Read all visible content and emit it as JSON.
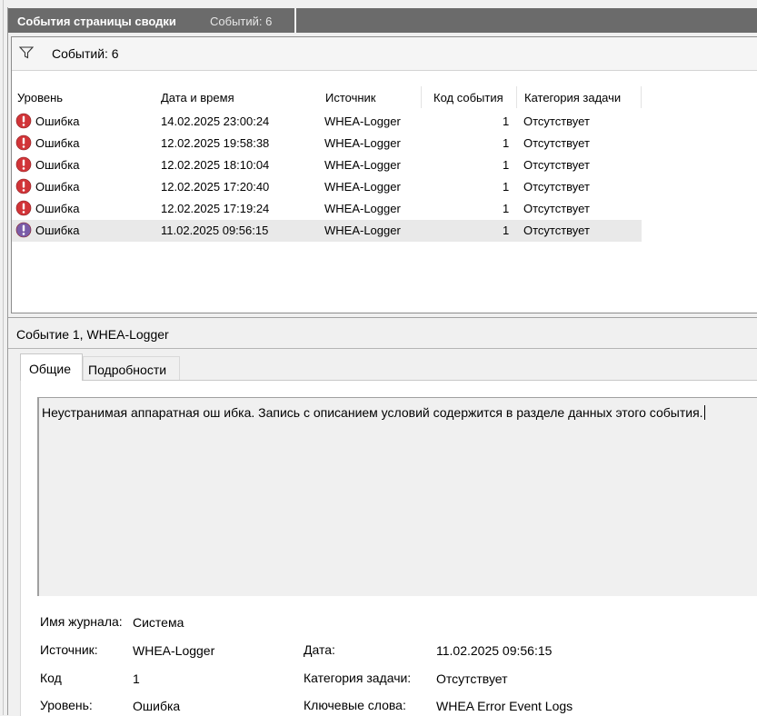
{
  "header": {
    "title": "События страницы сводки",
    "count": "Событий: 6"
  },
  "filter": {
    "count": "Событий: 6",
    "icon": "filter-icon"
  },
  "columns": [
    "Уровень",
    "Дата и время",
    "Источник",
    "Код события",
    "Категория задачи"
  ],
  "events": [
    {
      "level": "Ошибка",
      "datetime": "14.02.2025 23:00:24",
      "source": "WHEA-Logger",
      "code": "1",
      "category": "Отсутствует"
    },
    {
      "level": "Ошибка",
      "datetime": "12.02.2025 19:58:38",
      "source": "WHEA-Logger",
      "code": "1",
      "category": "Отсутствует"
    },
    {
      "level": "Ошибка",
      "datetime": "12.02.2025 18:10:04",
      "source": "WHEA-Logger",
      "code": "1",
      "category": "Отсутствует"
    },
    {
      "level": "Ошибка",
      "datetime": "12.02.2025 17:20:40",
      "source": "WHEA-Logger",
      "code": "1",
      "category": "Отсутствует"
    },
    {
      "level": "Ошибка",
      "datetime": "12.02.2025 17:19:24",
      "source": "WHEA-Logger",
      "code": "1",
      "category": "Отсутствует"
    },
    {
      "level": "Ошибка",
      "datetime": "11.02.2025 09:56:15",
      "source": "WHEA-Logger",
      "code": "1",
      "category": "Отсутствует"
    }
  ],
  "selected_row": 5,
  "detail": {
    "title": "Событие 1, WHEA-Logger",
    "tabs": [
      "Общие",
      "Подробности"
    ],
    "description": "Неустранимая аппаратная ош ибка. Запись с описанием условий содержится в разделе данных этого события.",
    "props": {
      "log_label": "Имя журнала:",
      "log_value": "Система",
      "source_label": "Источник:",
      "source_value": "WHEA-Logger",
      "code_label": "Код",
      "code_value": "1",
      "level_label": "Уровень:",
      "level_value": "Ошибка",
      "date_label": "Дата:",
      "date_value": "11.02.2025 09:56:15",
      "category_label": "Категория задачи:",
      "category_value": "Отсутствует",
      "keywords_label": "Ключевые слова:",
      "keywords_value": "WHEA Error Event Logs"
    }
  },
  "colors": {
    "header_bg": "#6b6b6b",
    "error_red": "#d13438",
    "selected_row": "#e9e9e9"
  }
}
